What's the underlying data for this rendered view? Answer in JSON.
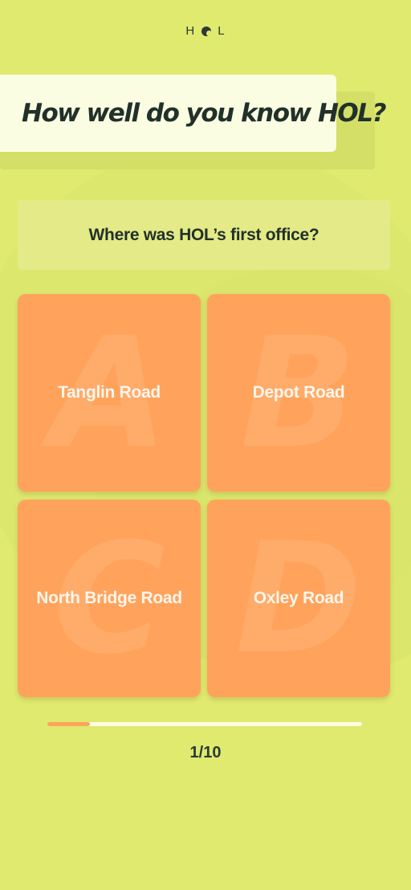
{
  "header": {
    "logo_left": "H",
    "logo_icon": "half-moon-icon",
    "logo_right": "L"
  },
  "quiz": {
    "title": "How well do you know HOL?",
    "question": "Where was HOL’s first office?",
    "options": [
      {
        "letter": "A",
        "label": "Tanglin Road"
      },
      {
        "letter": "B",
        "label": "Depot Road"
      },
      {
        "letter": "C",
        "label": "North Bridge Road"
      },
      {
        "letter": "D",
        "label": "Oxley Road"
      }
    ]
  },
  "progress": {
    "current": 1,
    "total": 10,
    "fraction": 0.135,
    "text": "1/10"
  },
  "colors": {
    "background": "#dfea6f",
    "option": "#ffa35c",
    "title_card": "#fbfde2",
    "text_dark": "#22302a"
  }
}
